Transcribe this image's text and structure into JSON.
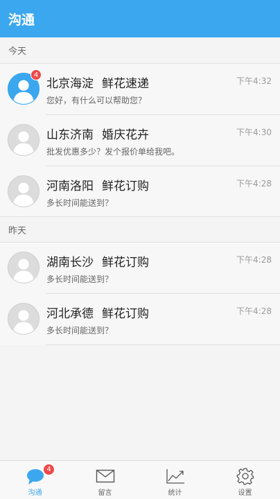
{
  "header": {
    "title": "沟通"
  },
  "sections": [
    {
      "label": "今天"
    },
    {
      "label": "昨天"
    }
  ],
  "conversations": [
    {
      "location": "北京海淀",
      "company": "鲜花速递",
      "message": "您好，有什么可以帮助您？",
      "time": "下午4:32",
      "badge": "4",
      "active_avatar": true
    },
    {
      "location": "山东济南",
      "company": "婚庆花卉",
      "message": "批发优惠多少？发个报价单给我吧。",
      "time": "下午4:30"
    },
    {
      "location": "河南洛阳",
      "company": "鲜花订购",
      "message": "多长时间能送到？",
      "time": "下午4:28"
    },
    {
      "location": "湖南长沙",
      "company": "鲜花订购",
      "message": "多长时间能送到？",
      "time": "下午4:28"
    },
    {
      "location": "河北承德",
      "company": "鲜花订购",
      "message": "多长时间能送到？",
      "time": "下午4:28"
    }
  ],
  "tabbar": {
    "tabs": [
      {
        "label": "沟通",
        "icon": "chat-bubble-icon",
        "active": true,
        "badge": "4"
      },
      {
        "label": "留言",
        "icon": "envelope-icon"
      },
      {
        "label": "统计",
        "icon": "chart-line-icon"
      },
      {
        "label": "设置",
        "icon": "gear-icon"
      }
    ]
  },
  "colors": {
    "accent": "#3aa7ee",
    "badge": "#f04848"
  }
}
